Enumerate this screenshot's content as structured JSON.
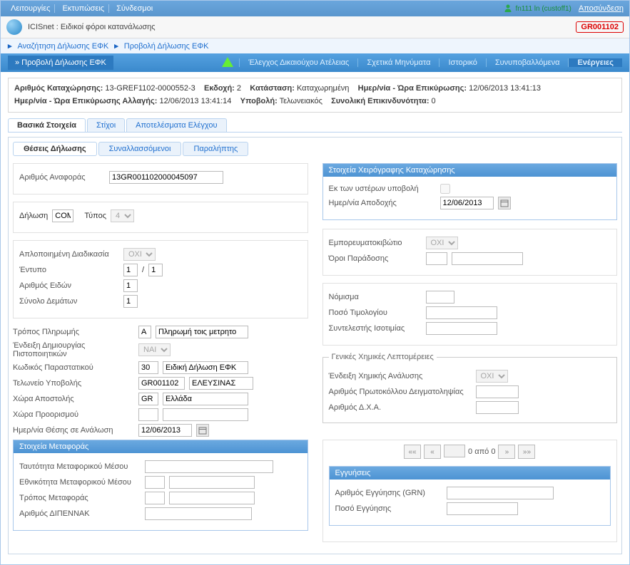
{
  "topbar": {
    "menu": [
      "Λειτουργίες",
      "Εκτυπώσεις",
      "Σύνδεσμοι"
    ],
    "user_name": "fn111 ln (custoff1)",
    "logout": "Αποσύνδεση"
  },
  "subhead": {
    "title": "ICISnet : Ειδικοί φόροι κατανάλωσης",
    "badge": "GR001102"
  },
  "breadcrumb": {
    "item1": "Αναζήτηση Δήλωσης ΕΦΚ",
    "item2": "Προβολή Δήλωσης ΕΦΚ"
  },
  "navbar": {
    "page_title": "» Προβολή Δήλωσης ΕΦΚ",
    "items": [
      "Έλεγχος Δικαιούχου Ατέλειας",
      "Σχετικά Μηνύματα",
      "Ιστορικό",
      "Συνυποβαλλόμενα",
      "Ενέργειες"
    ]
  },
  "meta": {
    "reg_no_lbl": "Αριθμός Καταχώρησης:",
    "reg_no": "13-GREF1102-0000552-3",
    "ekdosi_lbl": "Εκδοχή:",
    "ekdosi": "2",
    "status_lbl": "Κατάσταση:",
    "status": "Καταχωρημένη",
    "validate_dt_lbl": "Ημερ/νία - Ώρα Επικύρωσης:",
    "validate_dt": "12/06/2013 13:41:13",
    "change_dt_lbl": "Ημερ/νία - Ώρα Επικύρωσης Αλλαγής:",
    "change_dt": "12/06/2013 13:41:14",
    "submit_lbl": "Υποβολή:",
    "submit": "Τελωνειακός",
    "risk_lbl": "Συνολική Επικινδυνότητα:",
    "risk": "0"
  },
  "tabs_main": [
    "Βασικά Στοιχεία",
    "Στίχοι",
    "Αποτελέσματα Ελέγχου"
  ],
  "tabs_sub": [
    "Θέσεις Δήλωσης",
    "Συναλλασσόμενοι",
    "Παραλήπτης"
  ],
  "left": {
    "ref_lbl": "Αριθμός Αναφοράς",
    "ref": "13GR001102000045097",
    "dilosi_lbl": "Δήλωση",
    "dilosi": "COM",
    "typos_lbl": "Τύπος",
    "typos": "4",
    "simpl_lbl": "Απλοποιημένη Διαδικασία",
    "simpl": "ΟΧΙ",
    "entypo_lbl": "Έντυπο",
    "entypo_a": "1",
    "entypo_b": "1",
    "eidon_lbl": "Αριθμός Ειδών",
    "eidon": "1",
    "dematon_lbl": "Σύνολο Δεμάτων",
    "dematon": "1",
    "pay_lbl": "Τρόπος Πληρωμής",
    "pay_code": "A",
    "pay_desc": "Πληρωμή τοις μετρητο",
    "cert_lbl": "Ένδειξη Δημιουργίας Πιστοποιητικών",
    "cert": "ΝΑΙ",
    "doc_lbl": "Κωδικός Παραστατικού",
    "doc_code": "30",
    "doc_desc": "Ειδική Δήλωση ΕΦΚ",
    "cust_lbl": "Τελωνείο Υποβολής",
    "cust_code": "GR001102",
    "cust_desc": "ΕΛΕΥΣΙΝΑΣ",
    "dispatch_lbl": "Χώρα Αποστολής",
    "dispatch_code": "GR",
    "dispatch_desc": "Ελλάδα",
    "dest_lbl": "Χώρα Προορισμού",
    "consume_dt_lbl": "Ημερ/νία Θέσης σε Ανάλωση",
    "consume_dt": "12/06/2013"
  },
  "right": {
    "manual_title": "Στοιχεία Χειρόγραφης Καταχώρησης",
    "late_lbl": "Εκ των υστέρων υποβολή",
    "accept_dt_lbl": "Ημερ/νία Αποδοχής",
    "accept_dt": "12/06/2013",
    "container_lbl": "Εμπορευματοκιβώτιο",
    "container": "ΟΧΙ",
    "delivery_lbl": "Όροι Παράδοσης",
    "currency_lbl": "Νόμισμα",
    "invoice_lbl": "Ποσό Τιμολογίου",
    "rate_lbl": "Συντελεστής Ισοτιμίας",
    "chem_title": "Γενικές Χημικές Λεπτομέρειες",
    "chem_ind_lbl": "Ένδειξη Χημικής Ανάλυσης",
    "chem_ind": "ΟΧΙ",
    "protocol_lbl": "Αριθμός Πρωτοκόλλου Δειγματοληψίας",
    "dxa_lbl": "Αριθμός Δ.Χ.Α."
  },
  "transport": {
    "title": "Στοιχεία Μεταφοράς",
    "identity_lbl": "Ταυτότητα Μεταφορικού Μέσου",
    "nationality_lbl": "Εθνικότητα Μεταφορικού Μέσου",
    "mode_lbl": "Τρόπος Μεταφοράς",
    "dipennak_lbl": "Αριθμός ΔΙΠΕΝΝΑΚ"
  },
  "pager": {
    "val": "",
    "label": "0 από 0"
  },
  "guarantee": {
    "title": "Εγγυήσεις",
    "grn_lbl": "Αριθμός Εγγύησης (GRN)",
    "amount_lbl": "Ποσό Εγγύησης"
  }
}
